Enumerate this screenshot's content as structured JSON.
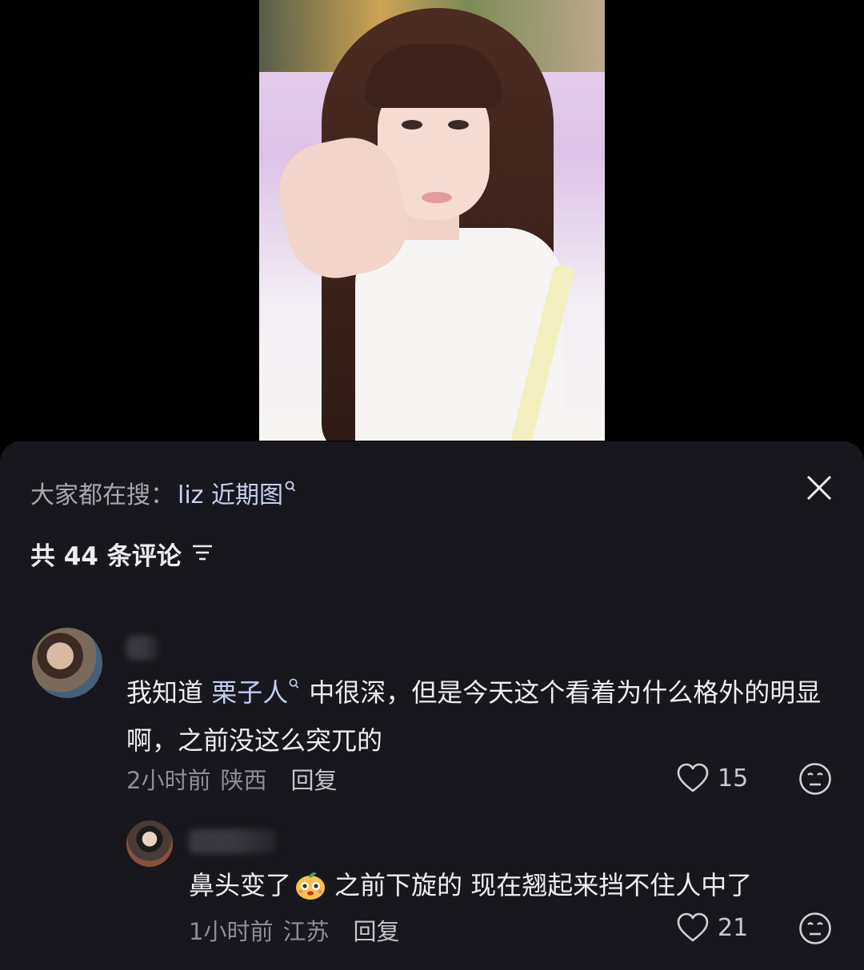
{
  "panel": {
    "search_prefix": "大家都在搜：",
    "search_keyword": "liz 近期图",
    "comment_count_text": "共 44 条评论",
    "icons": {
      "close": "close-icon",
      "filter": "filter-icon",
      "search": "search-icon",
      "like": "heart-icon",
      "dislike": "meh-face-icon"
    }
  },
  "comments": [
    {
      "text_before": "我知道",
      "mention": "栗子人",
      "text_after": "中很深，但是今天这个看着为什么格外的明显啊，之前没这么突兀的",
      "time": "2小时前",
      "location": "陕西",
      "reply_label": "回复",
      "likes": "15"
    },
    {
      "text_before": "鼻头变了",
      "emoji": "mango-emoji",
      "text_after": "之前下旋的 现在翘起来挡不住人中了",
      "time": "1小时前",
      "location": "江苏",
      "reply_label": "回复",
      "likes": "21"
    }
  ],
  "colors": {
    "panel_bg": "#17171d",
    "page_bg": "#000000",
    "link": "#c3cdf0",
    "meta": "#8e8e96"
  }
}
